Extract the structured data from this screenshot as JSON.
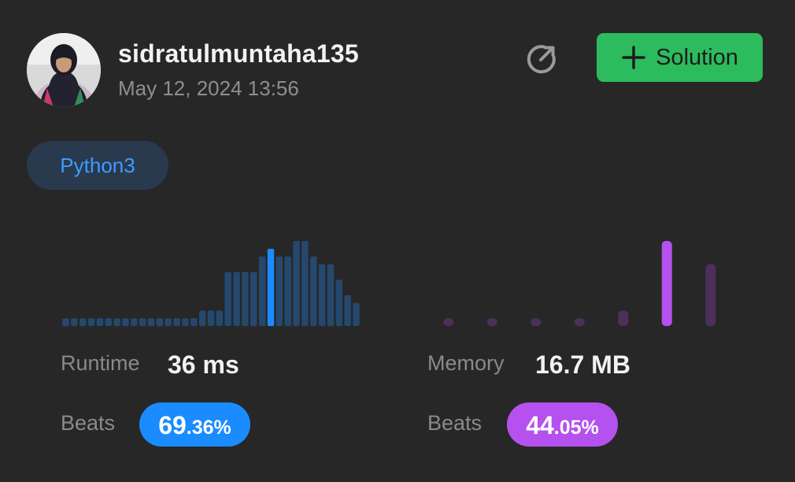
{
  "header": {
    "username": "sidratulmuntaha135",
    "timestamp": "May 12, 2024 13:56",
    "share_icon": "share-icon",
    "solution_button": {
      "icon": "plus-icon",
      "label": "Solution"
    }
  },
  "language": "Python3",
  "colors": {
    "background": "#272727",
    "accent_green": "#2cbb5d",
    "runtime_blue": "#1a8cff",
    "memory_purple": "#b551ee"
  },
  "runtime": {
    "label": "Runtime",
    "value": "36 ms",
    "beats_label": "Beats",
    "beats_integer": "69",
    "beats_decimal": ".36%"
  },
  "memory": {
    "label": "Memory",
    "value": "16.7 MB",
    "beats_label": "Beats",
    "beats_integer": "44",
    "beats_decimal": ".05%"
  },
  "chart_data": [
    {
      "type": "bar",
      "name": "runtime-distribution",
      "values": [
        1,
        1,
        1,
        1,
        1,
        1,
        1,
        1,
        1,
        1,
        1,
        1,
        1,
        1,
        1,
        1,
        2,
        2,
        2,
        7,
        7,
        7,
        7,
        9,
        10,
        9,
        9,
        11,
        11,
        9,
        8,
        8,
        6,
        4,
        3
      ],
      "highlight_index": 24,
      "ylim": [
        0,
        11
      ]
    },
    {
      "type": "bar",
      "name": "memory-distribution",
      "values": [
        1,
        1,
        1,
        1,
        2,
        11,
        8
      ],
      "highlight_index": 5,
      "ylim": [
        0,
        11
      ]
    }
  ]
}
